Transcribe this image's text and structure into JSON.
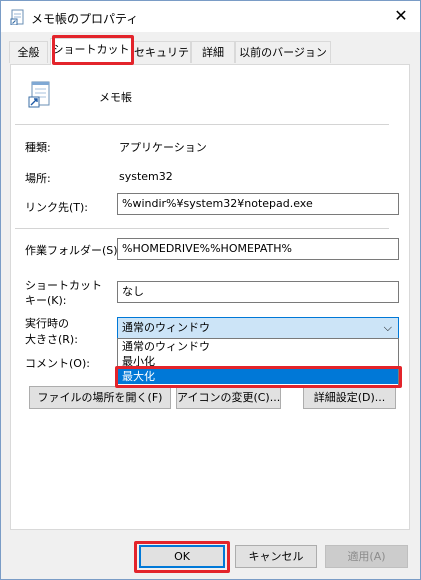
{
  "window": {
    "title": "メモ帳のプロパティ",
    "close_glyph": "✕",
    "accent_color": "#0078d7",
    "highlight_color": "#e3242b"
  },
  "tabs": [
    {
      "label": "全般"
    },
    {
      "label": "ショートカット"
    },
    {
      "label": "セキュリティ"
    },
    {
      "label": "詳細"
    },
    {
      "label": "以前のバージョン"
    }
  ],
  "shortcut": {
    "app_name": "メモ帳",
    "type_label": "種類:",
    "type_value": "アプリケーション",
    "location_label": "場所:",
    "location_value": "system32",
    "target_label": "リンク先(T):",
    "target_value": "%windir%¥system32¥notepad.exe",
    "start_in_label": "作業フォルダー(S):",
    "start_in_value": "%HOMEDRIVE%%HOMEPATH%",
    "shortcut_key_label_1": "ショートカット",
    "shortcut_key_label_2": "キー(K):",
    "shortcut_key_value": "なし",
    "run_label_1": "実行時の",
    "run_label_2": "大きさ(R):",
    "run_selected": "通常のウィンドウ",
    "run_options": [
      "通常のウィンドウ",
      "最小化",
      "最大化"
    ],
    "comment_label": "コメント(O):",
    "open_location_button": "ファイルの場所を開く(F)",
    "change_icon_button": "アイコンの変更(C)...",
    "advanced_button": "詳細設定(D)..."
  },
  "footer": {
    "ok": "OK",
    "cancel": "キャンセル",
    "apply": "適用(A)"
  }
}
